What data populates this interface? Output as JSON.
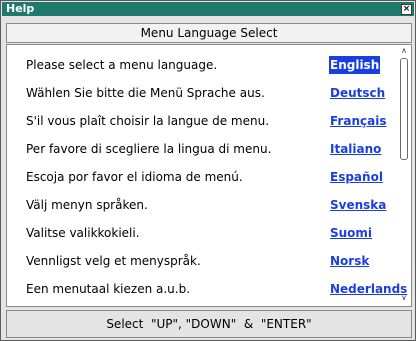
{
  "window": {
    "title": "Help",
    "close_glyph": "×"
  },
  "header": {
    "title": "Menu Language Select"
  },
  "languages": [
    {
      "prompt": "Please select a menu language.",
      "label": "English",
      "selected": true
    },
    {
      "prompt": "Wählen Sie bitte die Menü Sprache aus.",
      "label": "Deutsch",
      "selected": false
    },
    {
      "prompt": "S'il vous plaît choisir la langue de menu.",
      "label": "Français",
      "selected": false
    },
    {
      "prompt": "Per favore di scegliere la lingua di menu.",
      "label": "Italiano",
      "selected": false
    },
    {
      "prompt": "Escoja por favor el idioma de menú.",
      "label": "Español",
      "selected": false
    },
    {
      "prompt": "Välj menyn språken.",
      "label": "Svenska",
      "selected": false
    },
    {
      "prompt": "Valitse valikkokieli.",
      "label": "Suomi",
      "selected": false
    },
    {
      "prompt": "Vennligst velg et menyspråk.",
      "label": "Norsk",
      "selected": false
    },
    {
      "prompt": "Een menutaal kiezen a.u.b.",
      "label": "Nederlands",
      "selected": false
    }
  ],
  "scrollbar": {
    "up_glyph": "∧",
    "down_glyph": "∨"
  },
  "footer": {
    "hint": "Select  \"UP\", \"DOWN\"  &  \"ENTER\""
  },
  "colors": {
    "titlebar": "#207a6c",
    "link": "#1a3fe0",
    "selected_bg": "#1a3fe0"
  }
}
